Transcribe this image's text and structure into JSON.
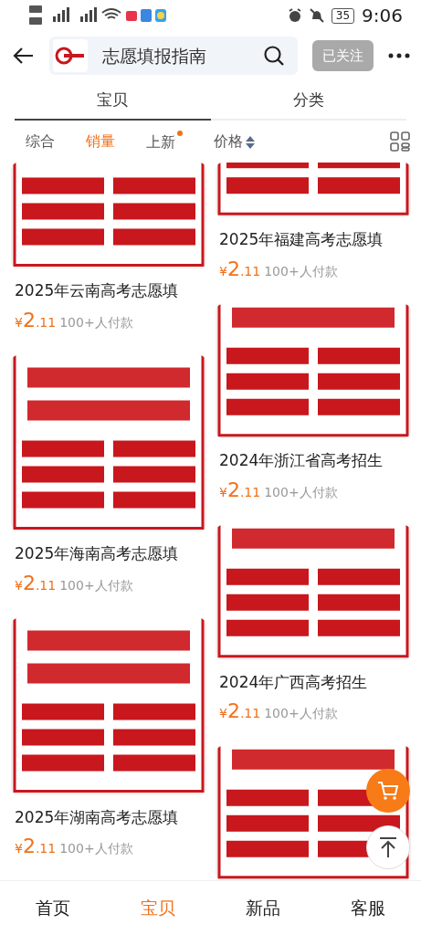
{
  "status_bar": {
    "time": "9:06",
    "battery": "35"
  },
  "header": {
    "search_text": "志愿填报指南",
    "follow_button": "已关注"
  },
  "tabs": [
    {
      "label": "宝贝",
      "selected": true
    },
    {
      "label": "分类",
      "selected": false
    }
  ],
  "sort_options": [
    {
      "label": "综合",
      "selected": false,
      "kind": "plain"
    },
    {
      "label": "销量",
      "selected": true,
      "kind": "plain"
    },
    {
      "label": "上新",
      "selected": false,
      "kind": "dot"
    },
    {
      "label": "价格",
      "selected": false,
      "kind": "sortable"
    }
  ],
  "products": {
    "left": [
      {
        "title": "2025年云南高考志愿填",
        "currency": "¥",
        "price_int": "2",
        "price_dec": ".11",
        "sales": "100+人付款"
      },
      {
        "title": "2025年海南高考志愿填",
        "currency": "¥",
        "price_int": "2",
        "price_dec": ".11",
        "sales": "100+人付款"
      },
      {
        "title": "2025年湖南高考志愿填",
        "currency": "¥",
        "price_int": "2",
        "price_dec": ".11",
        "sales": "100+人付款"
      }
    ],
    "right": [
      {
        "title": "2025年福建高考志愿填",
        "currency": "¥",
        "price_int": "2",
        "price_dec": ".11",
        "sales": "100+人付款"
      },
      {
        "title": "2024年浙江省高考招生",
        "currency": "¥",
        "price_int": "2",
        "price_dec": ".11",
        "sales": "100+人付款"
      },
      {
        "title": "2024年广西高考招生",
        "currency": "¥",
        "price_int": "2",
        "price_dec": ".11",
        "sales": "100+人付款"
      },
      {
        "kind": "picture"
      }
    ]
  },
  "bottom_nav": [
    {
      "label": "首页",
      "selected": false
    },
    {
      "label": "宝贝",
      "selected": true
    },
    {
      "label": "新品",
      "selected": false
    },
    {
      "label": "客服",
      "selected": false
    }
  ]
}
